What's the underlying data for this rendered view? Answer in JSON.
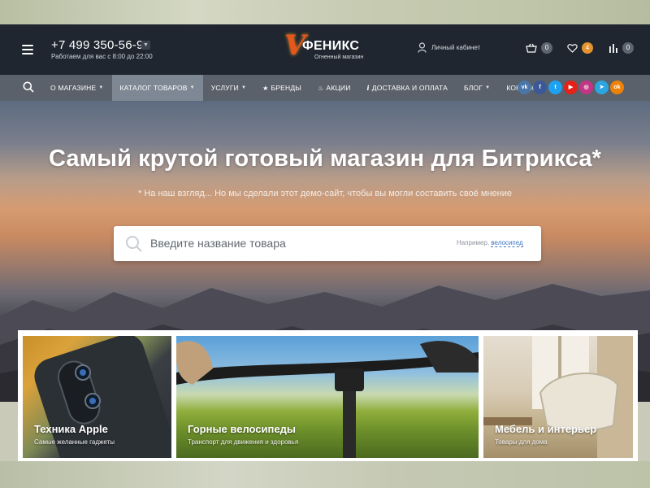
{
  "header": {
    "phone": "+7 499 350-56-97",
    "hours": "Работаем для вас с 8:00 до 22:00",
    "logo_name": "ФЕНИКС",
    "logo_tagline": "Огненный магазин",
    "account_label": "Личный кабинет",
    "cart_count": "0",
    "favorites_count": "4",
    "compare_count": "0"
  },
  "nav": {
    "items": [
      {
        "label": "О МАГАЗИНЕ"
      },
      {
        "label": "КАТАЛОГ ТОВАРОВ"
      },
      {
        "label": "УСЛУГИ"
      },
      {
        "label": "БРЕНДЫ"
      },
      {
        "label": "АКЦИИ"
      },
      {
        "label": "ДОСТАВКА И ОПЛАТА"
      },
      {
        "label": "БЛОГ"
      },
      {
        "label": "КОНТАКТЫ"
      }
    ],
    "socials": [
      {
        "name": "vk",
        "glyph": "vk",
        "color": "#4a76a8"
      },
      {
        "name": "facebook",
        "glyph": "f",
        "color": "#3b5998"
      },
      {
        "name": "twitter",
        "glyph": "t",
        "color": "#1da1f2"
      },
      {
        "name": "youtube",
        "glyph": "▶",
        "color": "#e62117"
      },
      {
        "name": "instagram",
        "glyph": "◎",
        "color": "#c13584"
      },
      {
        "name": "telegram",
        "glyph": "➤",
        "color": "#2ca5e0"
      },
      {
        "name": "odnoklassniki",
        "glyph": "ok",
        "color": "#ee8208"
      }
    ]
  },
  "hero": {
    "title": "Самый крутой готовый магазин для Битрикса*",
    "subtitle": "* На наш взгляд... Но мы сделали этот демо-сайт, чтобы вы могли составить своё мнение",
    "search_placeholder": "Введите название товара",
    "search_hint_prefix": "Например,",
    "search_hint_example": "велосипед"
  },
  "cards": [
    {
      "title": "Техника Apple",
      "subtitle": "Самые желанные гаджеты"
    },
    {
      "title": "Горные велосипеды",
      "subtitle": "Транспорт для движения и здоровья"
    },
    {
      "title": "Мебель и интерьер",
      "subtitle": "Товары для дома"
    }
  ],
  "colors": {
    "header_bg": "#1f262f",
    "nav_bg": "#505863",
    "nav_active": "#7e8894",
    "accent_orange": "#e4932d",
    "link_blue": "#3b74c4"
  }
}
